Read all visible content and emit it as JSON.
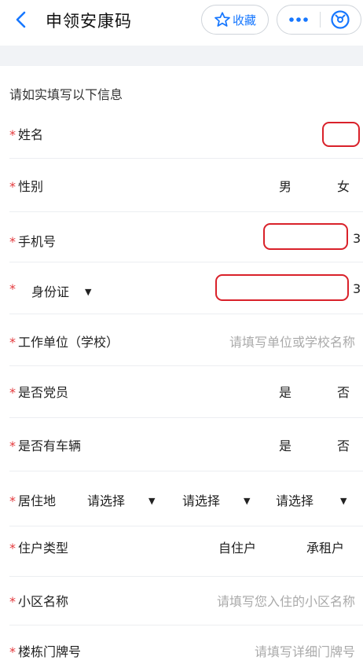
{
  "header": {
    "title": "申领安康码",
    "favorite_label": "收藏"
  },
  "form": {
    "intro": "请如实填写以下信息",
    "required_mark": "*",
    "fields": {
      "name": {
        "label": "姓名"
      },
      "gender": {
        "label": "性别",
        "options": [
          "男",
          "女"
        ]
      },
      "phone": {
        "label": "手机号",
        "visible_tail": "3"
      },
      "id_card": {
        "label": "身份证",
        "visible_tail": "3"
      },
      "work_unit": {
        "label": "工作单位（学校）",
        "placeholder": "请填写单位或学校名称"
      },
      "party_member": {
        "label": "是否党员",
        "options": [
          "是",
          "否"
        ]
      },
      "has_vehicle": {
        "label": "是否有车辆",
        "options": [
          "是",
          "否"
        ]
      },
      "residence": {
        "label": "居住地",
        "selects": [
          "请选择",
          "请选择",
          "请选择"
        ]
      },
      "household_type": {
        "label": "住户类型",
        "options": [
          "自住户",
          "承租户"
        ]
      },
      "community": {
        "label": "小区名称",
        "placeholder": "请填写您入住的小区名称"
      },
      "building": {
        "label": "楼栋门牌号",
        "placeholder": "请填写详细门牌号"
      }
    }
  },
  "colors": {
    "accent": "#1677ff",
    "required": "#e4393c",
    "annotation": "#d9212a",
    "spacer": "#f1f3f6"
  },
  "icons": {
    "back": "chevron-left-icon",
    "favorite": "star-outline-icon",
    "more": "more-dots-icon",
    "close": "close-circle-icon"
  }
}
